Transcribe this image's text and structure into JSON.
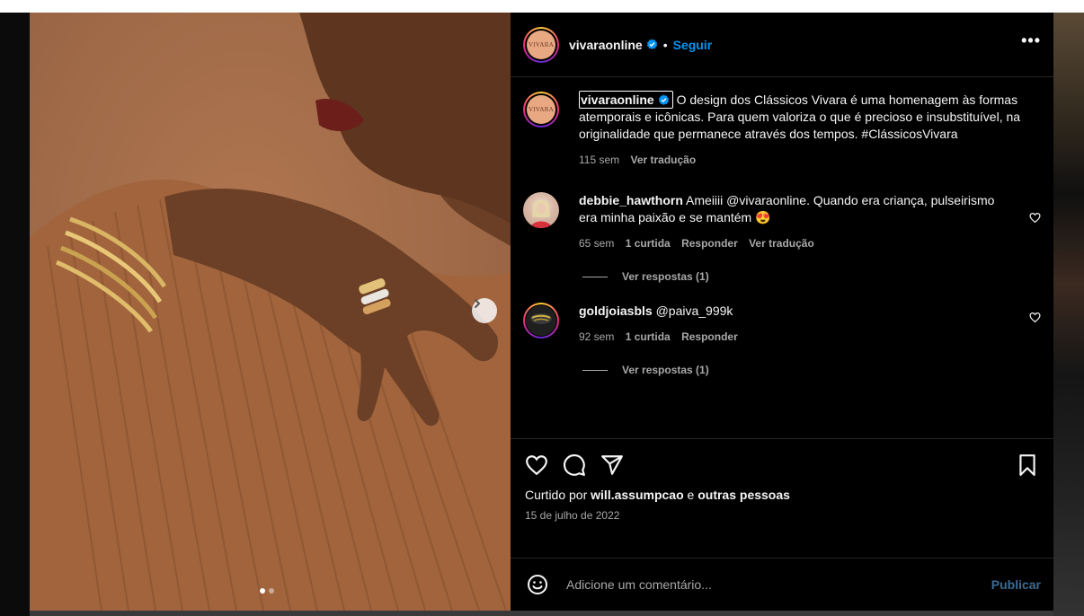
{
  "post": {
    "username": "vivaraonline",
    "follow_label": "Seguir",
    "separator": "•",
    "more_label": "•••",
    "avatar_text": "VIVARA",
    "caption": "O design dos Clássicos Vivara é uma homenagem às formas atemporais e icônicas. Para quem valoriza o que é precioso e insubstituível, na originalidade que permanece através dos tempos. #ClássicosVivara",
    "caption_time": "115 sem",
    "caption_translate": "Ver tradução",
    "carousel": {
      "total": 2,
      "current": 1
    }
  },
  "comments": [
    {
      "username": "debbie_hawthorn",
      "text": "Ameiiii @vivaraonline. Quando era criança, pulseirismo era minha paixão e se mantém 😍",
      "time": "65 sem",
      "likes": "1 curtida",
      "reply": "Responder",
      "translate": "Ver tradução",
      "view_replies": "Ver respostas (1)"
    },
    {
      "username": "goldjoiasbls",
      "text": "@paiva_999k",
      "time": "92 sem",
      "likes": "1 curtida",
      "reply": "Responder",
      "view_replies": "Ver respostas (1)"
    }
  ],
  "likes_line": {
    "prefix": "Curtido por",
    "user": "will.assumpcao",
    "and": "e",
    "others": "outras pessoas"
  },
  "date": "15 de julho de 2022",
  "add_comment": {
    "placeholder": "Adicione um comentário...",
    "publish": "Publicar"
  },
  "colors": {
    "link": "#0095f6",
    "verified": "#0095f6",
    "panel": "#000000",
    "muted": "#a8a8a8"
  }
}
